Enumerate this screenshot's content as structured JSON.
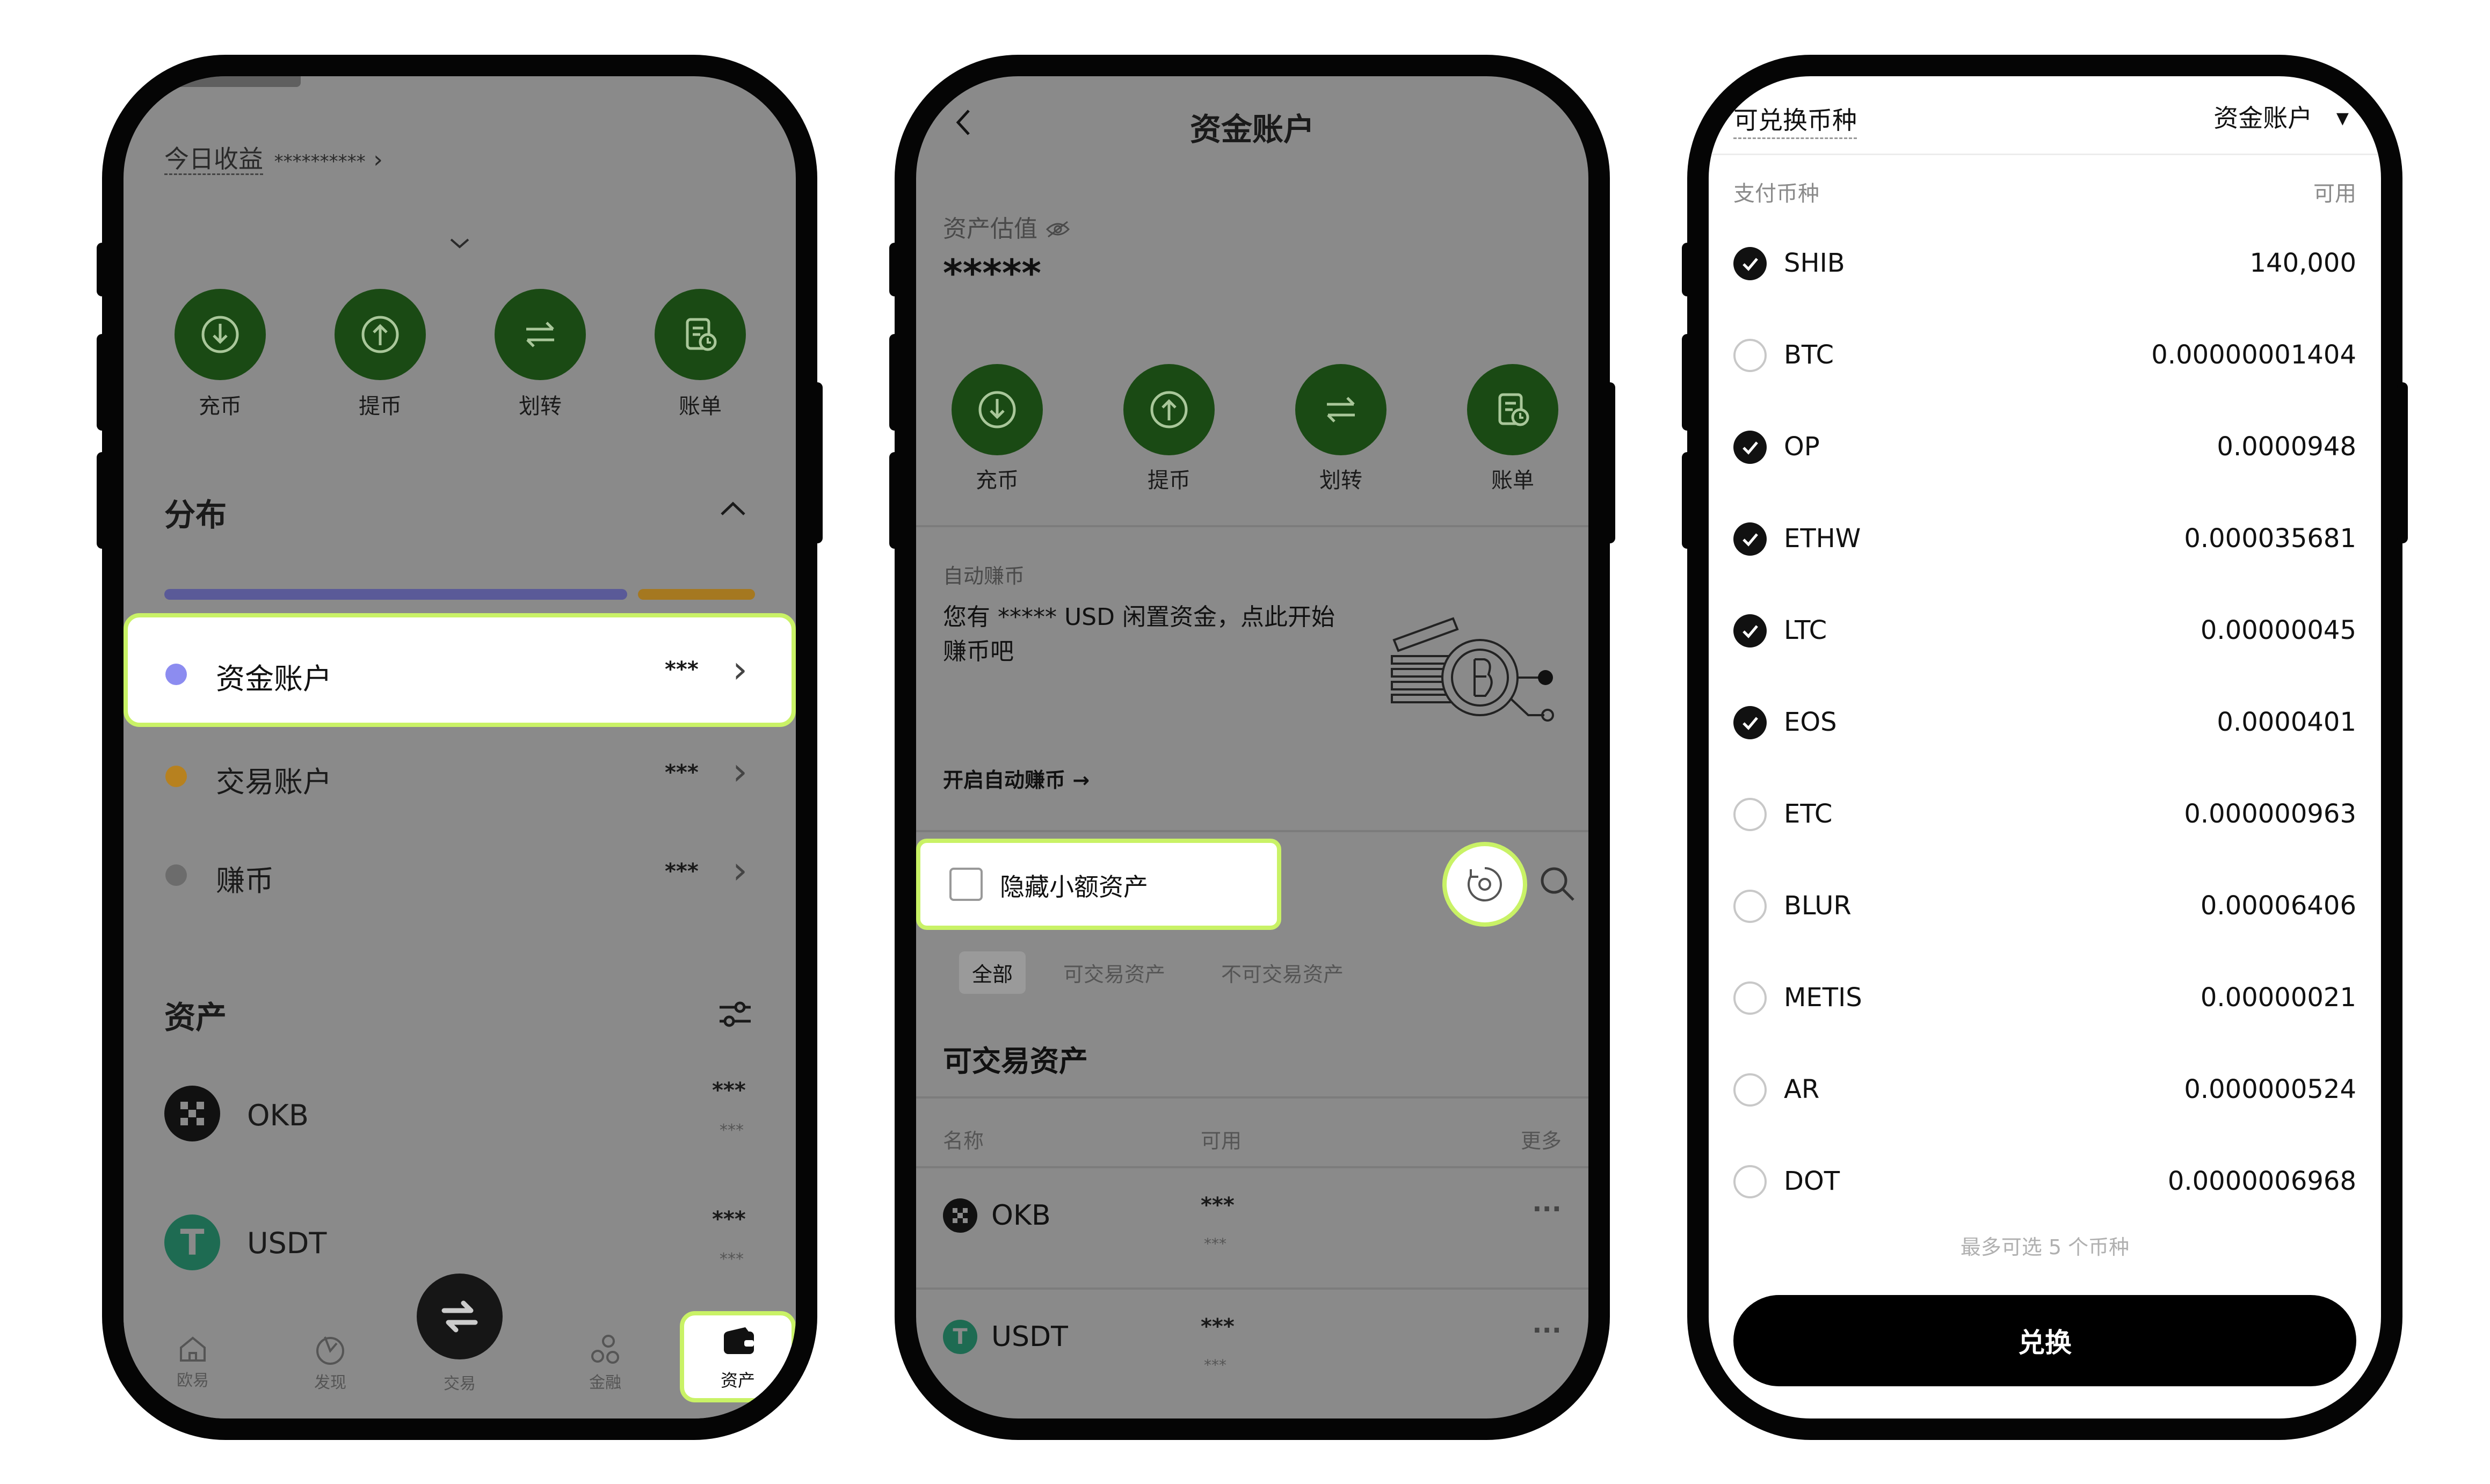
{
  "phone1": {
    "today_label": "今日收益",
    "today_value": "**********",
    "actions": [
      "充币",
      "提币",
      "划转",
      "账单"
    ],
    "distribution_title": "分布",
    "accounts": [
      {
        "name": "资金账户",
        "value": "***",
        "color": "#8c8cf0"
      },
      {
        "name": "交易账户",
        "value": "***",
        "color": "#b7811f"
      },
      {
        "name": "赚币",
        "value": "***",
        "color": "#6c6c6c"
      }
    ],
    "dist_bar_colors": [
      "#5a5a98",
      "#a57820"
    ],
    "assets_title": "资产",
    "assets": [
      {
        "name": "OKB",
        "value": "***",
        "sub": "***"
      },
      {
        "name": "USDT",
        "value": "***",
        "sub": "***"
      }
    ],
    "tabbar": [
      "欧易",
      "发现",
      "交易",
      "金融",
      "资产"
    ]
  },
  "phone2": {
    "title": "资金账户",
    "valuation_label": "资产估值",
    "valuation_value": "*****",
    "actions": [
      "充币",
      "提币",
      "划转",
      "账单"
    ],
    "auto_earn_label": "自动赚币",
    "auto_earn_text": "您有 ***** USD 闲置资金，点此开始赚币吧",
    "auto_earn_link": "开启自动赚币",
    "hide_small_label": "隐藏小额资产",
    "filters": [
      "全部",
      "可交易资产",
      "不可交易资产"
    ],
    "section_title": "可交易资产",
    "table_headers": [
      "名称",
      "可用",
      "更多"
    ],
    "rows": [
      {
        "name": "OKB",
        "value": "***",
        "sub": "***",
        "more": "···"
      },
      {
        "name": "USDT",
        "value": "***",
        "sub": "***",
        "more": "···"
      }
    ]
  },
  "phone3": {
    "header_left": "可兑换币种",
    "header_right": "资金账户",
    "col_left": "支付币种",
    "col_right": "可用",
    "coins": [
      {
        "name": "SHIB",
        "amount": "140,000",
        "checked": true
      },
      {
        "name": "BTC",
        "amount": "0.00000001404",
        "checked": false
      },
      {
        "name": "OP",
        "amount": "0.0000948",
        "checked": true
      },
      {
        "name": "ETHW",
        "amount": "0.000035681",
        "checked": true
      },
      {
        "name": "LTC",
        "amount": "0.00000045",
        "checked": true
      },
      {
        "name": "EOS",
        "amount": "0.0000401",
        "checked": true
      },
      {
        "name": "ETC",
        "amount": "0.000000963",
        "checked": false
      },
      {
        "name": "BLUR",
        "amount": "0.00006406",
        "checked": false
      },
      {
        "name": "METIS",
        "amount": "0.00000021",
        "checked": false
      },
      {
        "name": "AR",
        "amount": "0.000000524",
        "checked": false
      },
      {
        "name": "DOT",
        "amount": "0.0000006968",
        "checked": false
      }
    ],
    "footnote": "最多可选 5 个币种",
    "convert_button": "兑换"
  }
}
